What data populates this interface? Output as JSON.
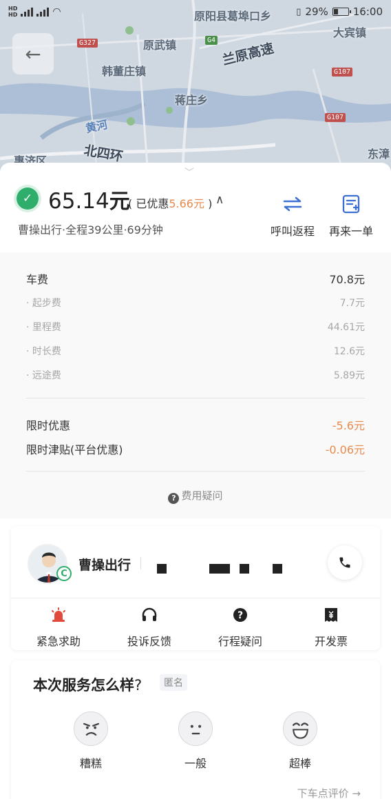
{
  "status_bar": {
    "net1": "HD",
    "net2": "HD",
    "battery": "29%",
    "time": "16:00"
  },
  "map": {
    "labels": [
      "原阳县葛埠口乡",
      "原武镇",
      "兰原高速",
      "大宾镇",
      "韩董庄镇",
      "蒋庄乡",
      "黄河",
      "北四环",
      "东漳",
      "惠济区"
    ],
    "road_badges": [
      "G327",
      "G4",
      "G107",
      "G107"
    ]
  },
  "summary": {
    "price": "65.14",
    "price_unit": "元",
    "discount_prefix": "已优惠",
    "discount_value": "5.66元",
    "trip_info": "曹操出行·全程39公里·69分钟",
    "actions": [
      {
        "label": "呼叫返程",
        "icon": "swap-arrows-icon"
      },
      {
        "label": "再来一单",
        "icon": "reorder-icon"
      }
    ]
  },
  "fare": {
    "total": {
      "label": "车费",
      "value": "70.8元"
    },
    "items": [
      {
        "label": "起步费",
        "value": "7.7元"
      },
      {
        "label": "里程费",
        "value": "44.61元"
      },
      {
        "label": "时长费",
        "value": "12.6元"
      },
      {
        "label": "远途费",
        "value": "5.89元"
      }
    ],
    "discounts": [
      {
        "label": "限时优惠",
        "value": "-5.6元"
      },
      {
        "label": "限时津贴(平台优惠)",
        "value": "-0.06元"
      }
    ],
    "question": "费用疑问"
  },
  "driver": {
    "company": "曹操出行",
    "badge": "C",
    "actions": [
      {
        "label": "紧急求助",
        "icon": "alarm-icon"
      },
      {
        "label": "投诉反馈",
        "icon": "headset-icon"
      },
      {
        "label": "行程疑问",
        "icon": "question-icon"
      },
      {
        "label": "开发票",
        "icon": "invoice-icon"
      }
    ]
  },
  "rating": {
    "title": "本次服务怎么样",
    "question_mark": "?",
    "anonymous": "匿名",
    "options": [
      {
        "label": "糟糕",
        "icon": "angry-face-icon"
      },
      {
        "label": "一般",
        "icon": "neutral-face-icon"
      },
      {
        "label": "超棒",
        "icon": "happy-face-icon"
      }
    ],
    "link": "下车点评价 →"
  },
  "colors": {
    "accent_blue": "#3b6fd2",
    "discount_orange": "#e8894b",
    "success_green": "#2fae6b"
  }
}
